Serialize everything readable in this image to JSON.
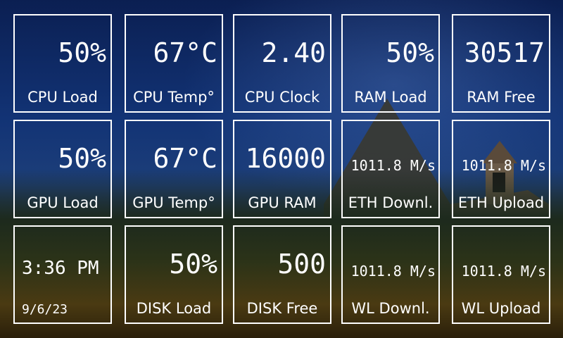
{
  "tiles": [
    {
      "value": "50%",
      "label": "CPU Load"
    },
    {
      "value": "67°C",
      "label": "CPU Temp°"
    },
    {
      "value": "2.40",
      "label": "CPU Clock"
    },
    {
      "value": "50%",
      "label": "RAM Load"
    },
    {
      "value": "30517",
      "label": "RAM Free"
    },
    {
      "value": "50%",
      "label": "GPU Load"
    },
    {
      "value": "67°C",
      "label": "GPU Temp°"
    },
    {
      "value": "16000",
      "label": "GPU RAM"
    },
    {
      "value": "1011.8 M/s",
      "label": "ETH Downl."
    },
    {
      "value": "1011.8 M/s",
      "label": "ETH Upload"
    },
    {
      "time": "3:36 PM",
      "date": "9/6/23"
    },
    {
      "value": "50%",
      "label": "DISK Load"
    },
    {
      "value": "500",
      "label": "DISK Free"
    },
    {
      "value": "1011.8 M/s",
      "label": "WL Downl."
    },
    {
      "value": "1011.8 M/s",
      "label": "WL Upload"
    }
  ]
}
